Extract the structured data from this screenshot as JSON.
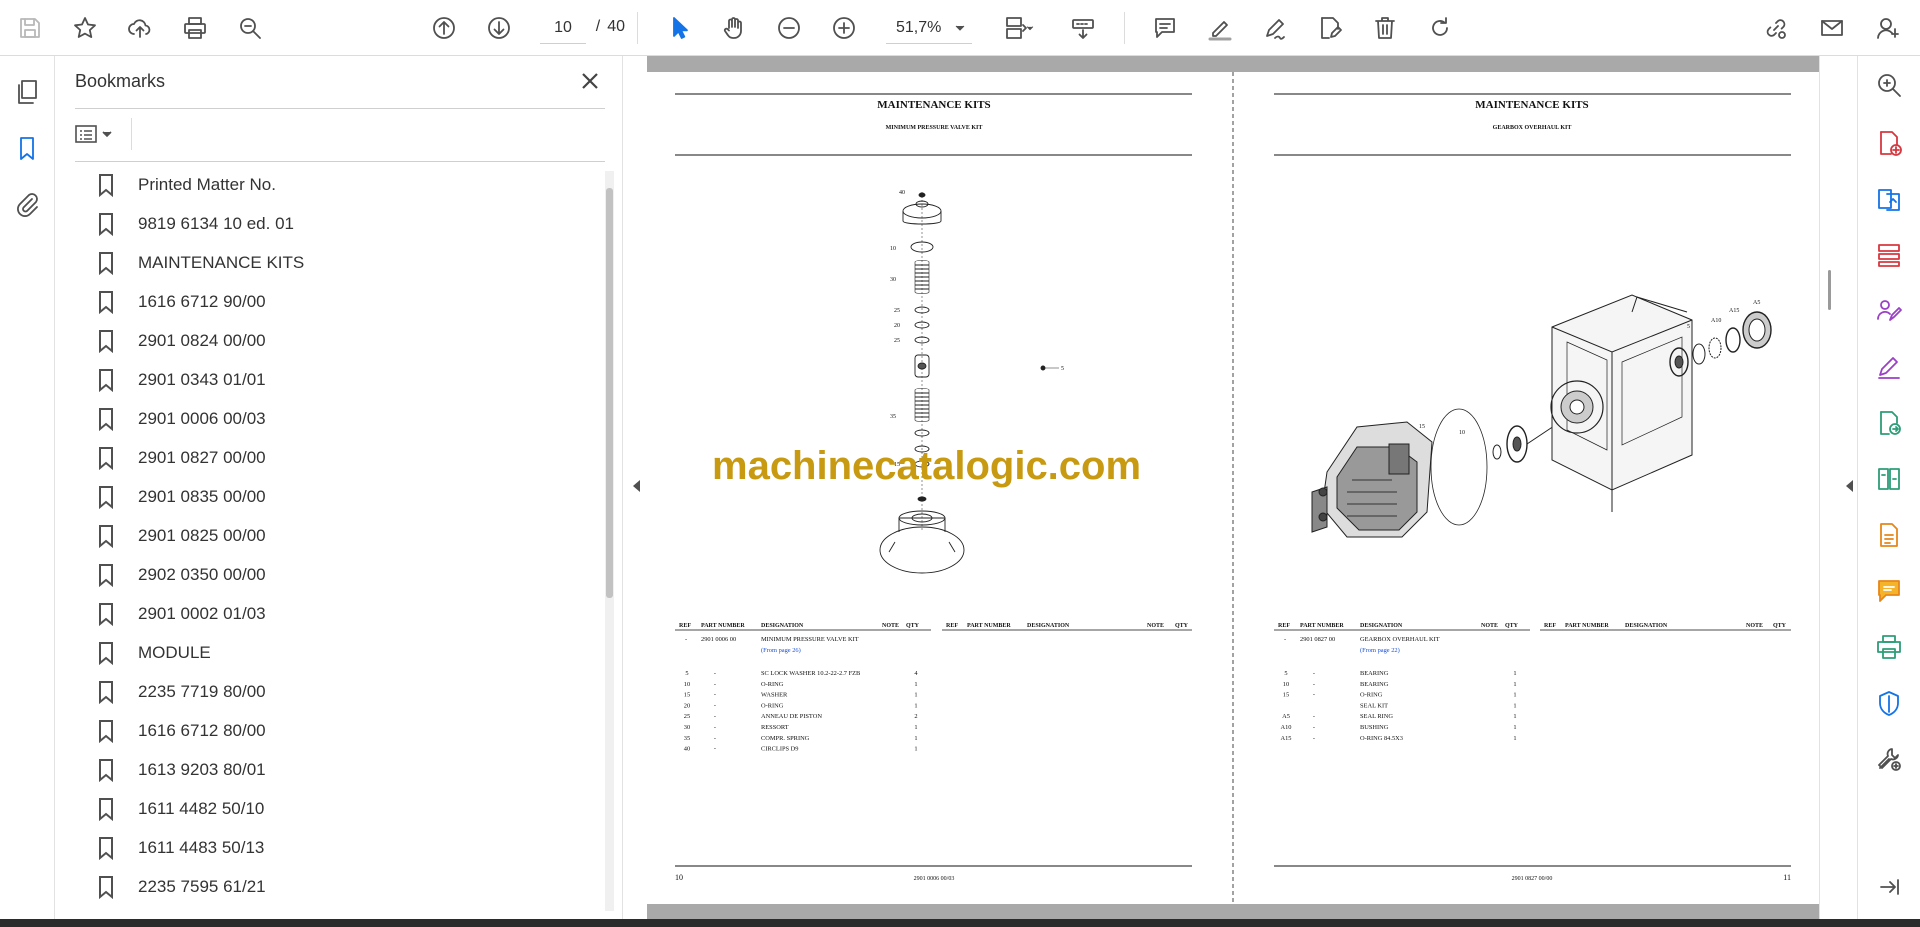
{
  "toolbar": {
    "page_current": "10",
    "page_separator": "/",
    "page_total": "40",
    "zoom": "51,7%"
  },
  "bookmarks": {
    "title": "Bookmarks",
    "items": [
      {
        "label": "Printed Matter No."
      },
      {
        "label": "9819 6134 10 ed. 01"
      },
      {
        "label": "MAINTENANCE KITS"
      },
      {
        "label": "1616 6712 90/00"
      },
      {
        "label": "2901 0824 00/00"
      },
      {
        "label": "2901 0343 01/01"
      },
      {
        "label": "2901 0006 00/03"
      },
      {
        "label": "2901 0827 00/00"
      },
      {
        "label": "2901 0835 00/00"
      },
      {
        "label": "2901 0825 00/00"
      },
      {
        "label": "2902 0350 00/00"
      },
      {
        "label": "2901 0002 01/03"
      },
      {
        "label": "MODULE"
      },
      {
        "label": "2235 7719 80/00"
      },
      {
        "label": "1616 6712 80/00"
      },
      {
        "label": "1613 9203 80/01"
      },
      {
        "label": "1611 4482 50/10"
      },
      {
        "label": "1611 4483 50/13"
      },
      {
        "label": "2235 7595 61/21"
      }
    ]
  },
  "document": {
    "watermark": "machinecatalogic.com",
    "left_page": {
      "title": "MAINTENANCE KITS",
      "subtitle": "MINIMUM PRESSURE VALVE KIT",
      "headers": [
        "REF",
        "PART NUMBER",
        "DESIGNATION",
        "NOTE",
        "QTY"
      ],
      "main_row": {
        "ref": "-",
        "part": "2901 0006 00",
        "designation": "MINIMUM PRESSURE VALVE KIT",
        "from": "(From page 26)"
      },
      "rows": [
        {
          "ref": "5",
          "part": "-",
          "designation": "SC LOCK WASHER 10.2-22-2.7 FZB",
          "qty": "4"
        },
        {
          "ref": "10",
          "part": "-",
          "designation": "O-RING",
          "qty": "1"
        },
        {
          "ref": "15",
          "part": "-",
          "designation": "WASHER",
          "qty": "1"
        },
        {
          "ref": "20",
          "part": "-",
          "designation": "O-RING",
          "qty": "1"
        },
        {
          "ref": "25",
          "part": "-",
          "designation": "ANNEAU DE PISTON",
          "qty": "2"
        },
        {
          "ref": "30",
          "part": "-",
          "designation": "RESSORT",
          "qty": "1"
        },
        {
          "ref": "35",
          "part": "-",
          "designation": "COMPR. SPRING",
          "qty": "1"
        },
        {
          "ref": "40",
          "part": "-",
          "designation": "CIRCLIPS D9",
          "qty": "1"
        }
      ],
      "footer_page": "10",
      "footer_code": "2901 0006 00/03",
      "callouts": [
        "40",
        "10",
        "30",
        "25",
        "20",
        "25",
        "35",
        "15",
        "5"
      ]
    },
    "right_page": {
      "title": "MAINTENANCE KITS",
      "subtitle": "GEARBOX OVERHAUL KIT",
      "headers": [
        "REF",
        "PART NUMBER",
        "DESIGNATION",
        "NOTE",
        "QTY"
      ],
      "main_row": {
        "ref": "-",
        "part": "2901 0827 00",
        "designation": "GEARBOX OVERHAUL KIT",
        "from": "(From page 22)"
      },
      "rows": [
        {
          "ref": "5",
          "part": "-",
          "designation": "BEARING",
          "qty": "1"
        },
        {
          "ref": "10",
          "part": "-",
          "designation": "BEARING",
          "qty": "1"
        },
        {
          "ref": "15",
          "part": "-",
          "designation": "O-RING",
          "qty": "1"
        },
        {
          "ref": "",
          "part": "",
          "designation": "SEAL KIT",
          "qty": "1"
        },
        {
          "ref": "A5",
          "part": "-",
          "designation": "SEAL RING",
          "qty": "1"
        },
        {
          "ref": "A10",
          "part": "-",
          "designation": "BUSHING",
          "qty": "1"
        },
        {
          "ref": "A15",
          "part": "-",
          "designation": "O-RING 84.5X3",
          "qty": "1"
        }
      ],
      "footer_page": "11",
      "footer_code": "2901 0827 00/00",
      "callouts": [
        "A5",
        "A15",
        "A10",
        "5",
        "15",
        "10"
      ]
    }
  },
  "colors": {
    "accent": "#1473e6",
    "watermark": "#c79a12",
    "link": "#1a4fd6"
  }
}
